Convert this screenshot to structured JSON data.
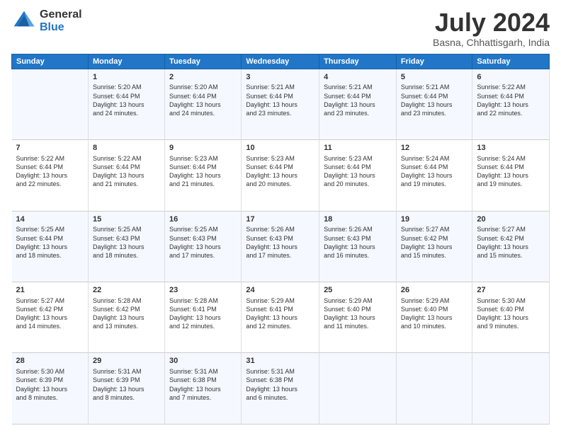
{
  "logo": {
    "general": "General",
    "blue": "Blue"
  },
  "header": {
    "month_year": "July 2024",
    "location": "Basna, Chhattisgarh, India"
  },
  "days_of_week": [
    "Sunday",
    "Monday",
    "Tuesday",
    "Wednesday",
    "Thursday",
    "Friday",
    "Saturday"
  ],
  "weeks": [
    {
      "cells": [
        {
          "day": "",
          "content": ""
        },
        {
          "day": "1",
          "content": "Sunrise: 5:20 AM\nSunset: 6:44 PM\nDaylight: 13 hours\nand 24 minutes."
        },
        {
          "day": "2",
          "content": "Sunrise: 5:20 AM\nSunset: 6:44 PM\nDaylight: 13 hours\nand 24 minutes."
        },
        {
          "day": "3",
          "content": "Sunrise: 5:21 AM\nSunset: 6:44 PM\nDaylight: 13 hours\nand 23 minutes."
        },
        {
          "day": "4",
          "content": "Sunrise: 5:21 AM\nSunset: 6:44 PM\nDaylight: 13 hours\nand 23 minutes."
        },
        {
          "day": "5",
          "content": "Sunrise: 5:21 AM\nSunset: 6:44 PM\nDaylight: 13 hours\nand 23 minutes."
        },
        {
          "day": "6",
          "content": "Sunrise: 5:22 AM\nSunset: 6:44 PM\nDaylight: 13 hours\nand 22 minutes."
        }
      ]
    },
    {
      "cells": [
        {
          "day": "7",
          "content": "Sunrise: 5:22 AM\nSunset: 6:44 PM\nDaylight: 13 hours\nand 22 minutes."
        },
        {
          "day": "8",
          "content": "Sunrise: 5:22 AM\nSunset: 6:44 PM\nDaylight: 13 hours\nand 21 minutes."
        },
        {
          "day": "9",
          "content": "Sunrise: 5:23 AM\nSunset: 6:44 PM\nDaylight: 13 hours\nand 21 minutes."
        },
        {
          "day": "10",
          "content": "Sunrise: 5:23 AM\nSunset: 6:44 PM\nDaylight: 13 hours\nand 20 minutes."
        },
        {
          "day": "11",
          "content": "Sunrise: 5:23 AM\nSunset: 6:44 PM\nDaylight: 13 hours\nand 20 minutes."
        },
        {
          "day": "12",
          "content": "Sunrise: 5:24 AM\nSunset: 6:44 PM\nDaylight: 13 hours\nand 19 minutes."
        },
        {
          "day": "13",
          "content": "Sunrise: 5:24 AM\nSunset: 6:44 PM\nDaylight: 13 hours\nand 19 minutes."
        }
      ]
    },
    {
      "cells": [
        {
          "day": "14",
          "content": "Sunrise: 5:25 AM\nSunset: 6:44 PM\nDaylight: 13 hours\nand 18 minutes."
        },
        {
          "day": "15",
          "content": "Sunrise: 5:25 AM\nSunset: 6:43 PM\nDaylight: 13 hours\nand 18 minutes."
        },
        {
          "day": "16",
          "content": "Sunrise: 5:25 AM\nSunset: 6:43 PM\nDaylight: 13 hours\nand 17 minutes."
        },
        {
          "day": "17",
          "content": "Sunrise: 5:26 AM\nSunset: 6:43 PM\nDaylight: 13 hours\nand 17 minutes."
        },
        {
          "day": "18",
          "content": "Sunrise: 5:26 AM\nSunset: 6:43 PM\nDaylight: 13 hours\nand 16 minutes."
        },
        {
          "day": "19",
          "content": "Sunrise: 5:27 AM\nSunset: 6:42 PM\nDaylight: 13 hours\nand 15 minutes."
        },
        {
          "day": "20",
          "content": "Sunrise: 5:27 AM\nSunset: 6:42 PM\nDaylight: 13 hours\nand 15 minutes."
        }
      ]
    },
    {
      "cells": [
        {
          "day": "21",
          "content": "Sunrise: 5:27 AM\nSunset: 6:42 PM\nDaylight: 13 hours\nand 14 minutes."
        },
        {
          "day": "22",
          "content": "Sunrise: 5:28 AM\nSunset: 6:42 PM\nDaylight: 13 hours\nand 13 minutes."
        },
        {
          "day": "23",
          "content": "Sunrise: 5:28 AM\nSunset: 6:41 PM\nDaylight: 13 hours\nand 12 minutes."
        },
        {
          "day": "24",
          "content": "Sunrise: 5:29 AM\nSunset: 6:41 PM\nDaylight: 13 hours\nand 12 minutes."
        },
        {
          "day": "25",
          "content": "Sunrise: 5:29 AM\nSunset: 6:40 PM\nDaylight: 13 hours\nand 11 minutes."
        },
        {
          "day": "26",
          "content": "Sunrise: 5:29 AM\nSunset: 6:40 PM\nDaylight: 13 hours\nand 10 minutes."
        },
        {
          "day": "27",
          "content": "Sunrise: 5:30 AM\nSunset: 6:40 PM\nDaylight: 13 hours\nand 9 minutes."
        }
      ]
    },
    {
      "cells": [
        {
          "day": "28",
          "content": "Sunrise: 5:30 AM\nSunset: 6:39 PM\nDaylight: 13 hours\nand 8 minutes."
        },
        {
          "day": "29",
          "content": "Sunrise: 5:31 AM\nSunset: 6:39 PM\nDaylight: 13 hours\nand 8 minutes."
        },
        {
          "day": "30",
          "content": "Sunrise: 5:31 AM\nSunset: 6:38 PM\nDaylight: 13 hours\nand 7 minutes."
        },
        {
          "day": "31",
          "content": "Sunrise: 5:31 AM\nSunset: 6:38 PM\nDaylight: 13 hours\nand 6 minutes."
        },
        {
          "day": "",
          "content": ""
        },
        {
          "day": "",
          "content": ""
        },
        {
          "day": "",
          "content": ""
        }
      ]
    }
  ]
}
